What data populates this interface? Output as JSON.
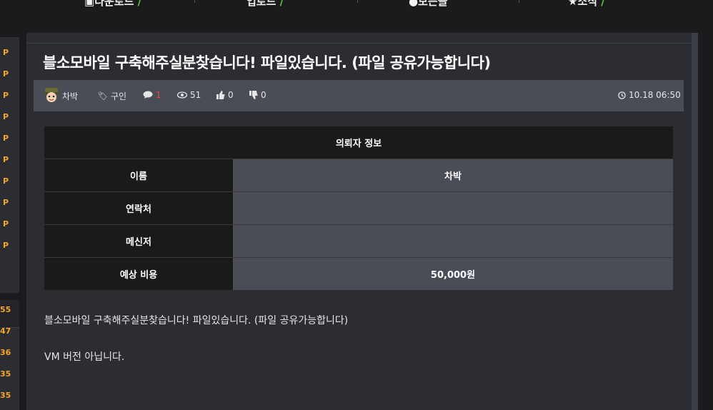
{
  "nav": {
    "items": [
      {
        "label": "다운로드"
      },
      {
        "label": "업로드"
      },
      {
        "label": "모든글"
      },
      {
        "label": "소식"
      }
    ]
  },
  "sidebar": {
    "point_marker": "P",
    "numbers": [
      "55",
      "47",
      "36",
      "35",
      "35"
    ]
  },
  "post": {
    "title": "블소모바일 구축해주실분찾습니다! 파일있습니다. (파일 공유가능합니다)",
    "author": "차박",
    "category": "구인",
    "comments": "1",
    "views": "51",
    "likes": "0",
    "dislikes": "0",
    "datetime": "10.18 06:50"
  },
  "requester": {
    "header": "의뢰자 정보",
    "rows": [
      {
        "label": "이름",
        "value": "차박"
      },
      {
        "label": "연락처",
        "value": ""
      },
      {
        "label": "메신저",
        "value": ""
      },
      {
        "label": "예상 비용",
        "value": "50,000원"
      }
    ]
  },
  "content": {
    "line1": "블소모바일 구축해주실분찾습니다! 파일있습니다. (파일 공유가능합니다)",
    "line2": "VM 버전 아닙니다."
  },
  "colors": {
    "background": "#1b1b1d",
    "panel": "#2b2d33",
    "meta_bar": "#4a4c56",
    "table_dark": "#1a1a1a",
    "accent_orange": "#f5a623",
    "comment_red": "#e5484d"
  }
}
